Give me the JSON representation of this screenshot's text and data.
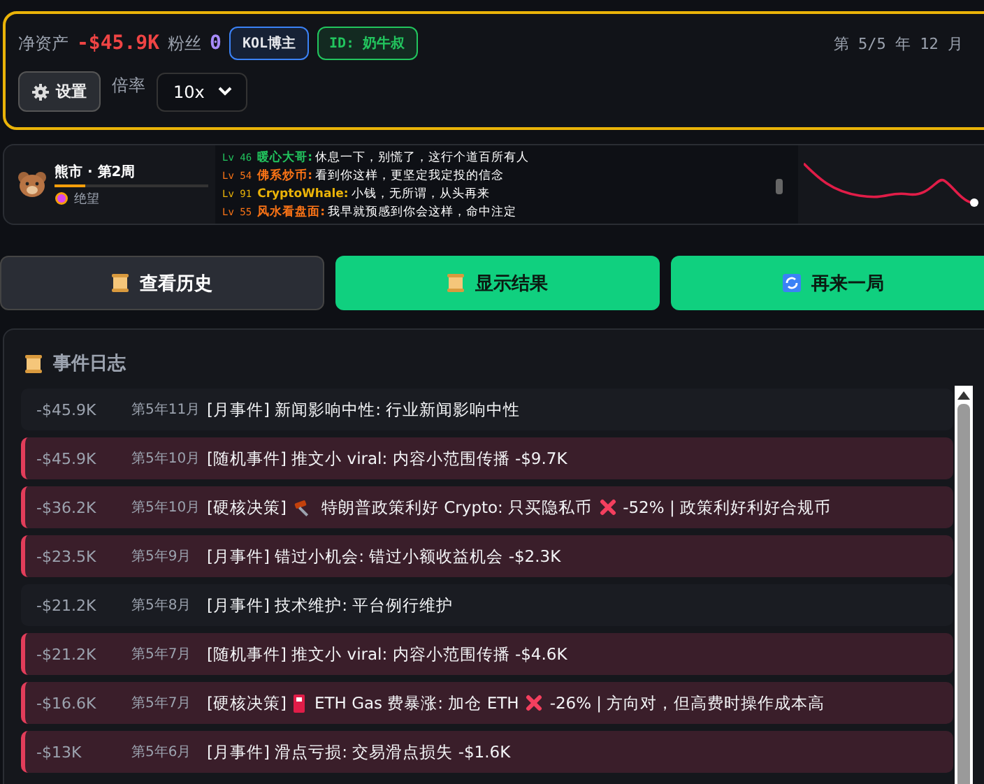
{
  "header": {
    "net_label": "净资产",
    "net_value": "-$45.9K",
    "fans_label": "粉丝",
    "fans_value": "0",
    "badges": [
      {
        "text": "KOL博主",
        "color": "#3b82f6"
      },
      {
        "text": "ID: 奶牛叔",
        "color": "#22c55e"
      }
    ],
    "date": "第 5/5 年 12 月",
    "settings_button": "设置",
    "rate_label": "倍率",
    "rate_value": "10x"
  },
  "market": {
    "title": "熊市 · 第2周",
    "level": 0.2,
    "mood": "绝望"
  },
  "chat": [
    {
      "level": "Lv 46",
      "name": "暖心大哥:",
      "text": "休息一下，别慌了，这行个道百所有人",
      "color": "#22c55e"
    },
    {
      "level": "Lv 54",
      "name": "佛系炒币:",
      "text": "看到你这样，更坚定我定投的信念",
      "color": "#f97316"
    },
    {
      "level": "Lv 91",
      "name": "CryptoWhale:",
      "text": "小钱，无所谓，从头再来",
      "color": "#eab308"
    },
    {
      "level": "Lv 55",
      "name": "风水看盘面:",
      "text": "我早就预感到你会这样，命中注定",
      "color": "#f97316"
    }
  ],
  "buttons": [
    {
      "label": "查看历史",
      "kind": "dark"
    },
    {
      "label": "显示结果",
      "kind": "green"
    },
    {
      "label": "再来一局",
      "kind": "green"
    }
  ],
  "log": {
    "title": "事件日志",
    "rows": [
      {
        "amount": "-$45.9K",
        "date": "第5年11月",
        "highlighted": false,
        "parts": [
          {
            "kind": "text",
            "text": "[月事件] 新闻影响中性: 行业新闻影响中性"
          }
        ]
      },
      {
        "amount": "-$45.9K",
        "date": "第5年10月",
        "highlighted": true,
        "parts": [
          {
            "kind": "text",
            "text": "[随机事件] 推文小 viral: 内容小范围传播 -$9.7K"
          }
        ]
      },
      {
        "amount": "-$36.2K",
        "date": "第5年10月",
        "highlighted": true,
        "parts": [
          {
            "kind": "text",
            "text": "[硬核决策]"
          },
          {
            "kind": "gavel"
          },
          {
            "kind": "text",
            "text": "特朗普政策利好 Crypto: 只买隐私币"
          },
          {
            "kind": "cross"
          },
          {
            "kind": "text",
            "text": "-52% | 政策利好利好合规币"
          }
        ]
      },
      {
        "amount": "-$23.5K",
        "date": "第5年9月",
        "highlighted": true,
        "parts": [
          {
            "kind": "text",
            "text": "[月事件] 错过小机会: 错过小额收益机会 -$2.3K"
          }
        ]
      },
      {
        "amount": "-$21.2K",
        "date": "第5年8月",
        "highlighted": false,
        "parts": [
          {
            "kind": "text",
            "text": "[月事件] 技术维护: 平台例行维护"
          }
        ]
      },
      {
        "amount": "-$21.2K",
        "date": "第5年7月",
        "highlighted": true,
        "parts": [
          {
            "kind": "text",
            "text": "[随机事件] 推文小 viral: 内容小范围传播 -$4.6K"
          }
        ]
      },
      {
        "amount": "-$16.6K",
        "date": "第5年7月",
        "highlighted": true,
        "parts": [
          {
            "kind": "text",
            "text": "[硬核决策]"
          },
          {
            "kind": "fuel"
          },
          {
            "kind": "text",
            "text": "ETH Gas 费暴涨: 加仓 ETH"
          },
          {
            "kind": "cross"
          },
          {
            "kind": "text",
            "text": "-26% | 方向对，但高费时操作成本高"
          }
        ]
      },
      {
        "amount": "-$13K",
        "date": "第5年6月",
        "highlighted": true,
        "parts": [
          {
            "kind": "text",
            "text": "[月事件] 滑点亏损: 交易滑点损失 -$1.6K"
          }
        ]
      }
    ]
  }
}
